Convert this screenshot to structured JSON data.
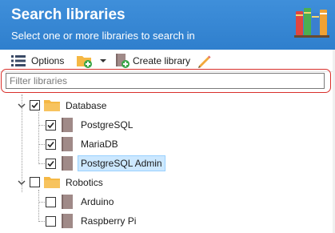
{
  "header": {
    "title": "Search libraries",
    "subtitle": "Select one or more libraries to search in"
  },
  "toolbar": {
    "options_label": "Options",
    "create_library_label": "Create library"
  },
  "filter": {
    "placeholder": "Filter libraries",
    "value": ""
  },
  "colors": {
    "header_bg": "#3185d4",
    "folder": "#f5b844",
    "book": "#a08a88",
    "selection": "#cce8ff",
    "highlight_border": "#d9302b"
  },
  "tree": [
    {
      "label": "Database",
      "checked": true,
      "expanded": true,
      "children": [
        {
          "label": "PostgreSQL",
          "checked": true,
          "selected": false
        },
        {
          "label": "MariaDB",
          "checked": true,
          "selected": false
        },
        {
          "label": "PostgreSQL Admin",
          "checked": true,
          "selected": true
        }
      ]
    },
    {
      "label": "Robotics",
      "checked": false,
      "expanded": true,
      "children": [
        {
          "label": "Arduino",
          "checked": false,
          "selected": false
        },
        {
          "label": "Raspberry Pi",
          "checked": false,
          "selected": false
        }
      ]
    }
  ]
}
